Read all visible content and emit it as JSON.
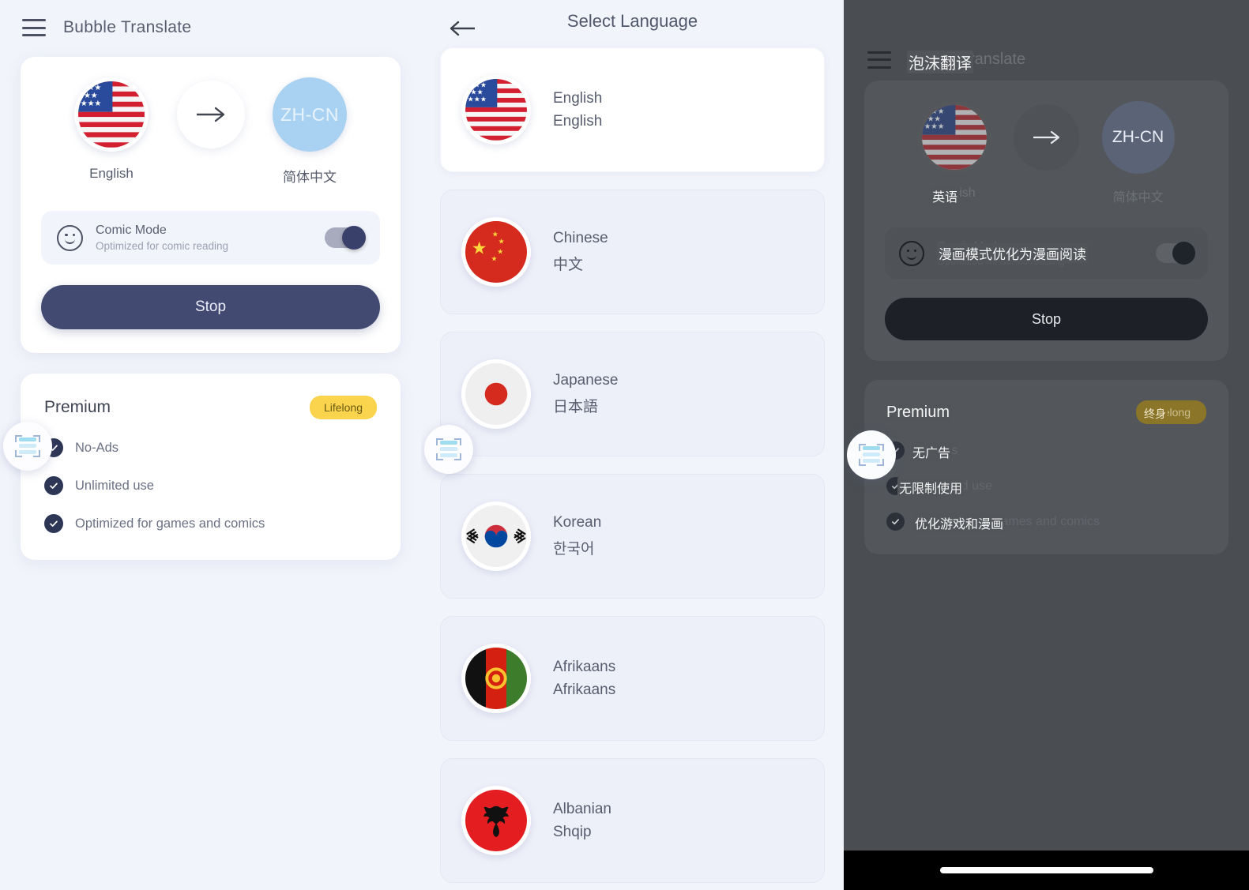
{
  "main_panel": {
    "header": {
      "menu_icon": "hamburger-icon",
      "title": "Bubble Translate"
    },
    "translate_card": {
      "source": {
        "label": "English",
        "flag": "us-flag"
      },
      "swap_icon": "arrow-right-icon",
      "target": {
        "label": "简体中文",
        "code": "ZH-CN"
      },
      "comic_mode": {
        "icon": "smiley-icon",
        "title": "Comic Mode",
        "subtitle": "Optimized for comic reading",
        "toggle_state": "on"
      },
      "action_button": "Stop"
    },
    "premium_card": {
      "title": "Premium",
      "badge": "Lifelong",
      "features": [
        "No-Ads",
        "Unlimited use",
        "Optimized for games and comics"
      ]
    },
    "floating_bubble": "translate-bubble-icon"
  },
  "language_panel": {
    "header": {
      "back_icon": "arrow-left-icon",
      "title": "Select Language"
    },
    "items": [
      {
        "name": "English",
        "native": "English",
        "flag": "us-flag",
        "selected": true
      },
      {
        "name": "Chinese",
        "native": "中文",
        "flag": "cn-flag",
        "selected": false
      },
      {
        "name": "Japanese",
        "native": "日本語",
        "flag": "jp-flag",
        "selected": false
      },
      {
        "name": "Korean",
        "native": "한국어",
        "flag": "kr-flag",
        "selected": false
      },
      {
        "name": "Afrikaans",
        "native": "Afrikaans",
        "flag": "af-flag",
        "selected": false
      },
      {
        "name": "Albanian",
        "native": "Shqip",
        "flag": "al-flag",
        "selected": false
      }
    ],
    "floating_bubble": "translate-bubble-icon"
  },
  "overlay_panel": {
    "header": {
      "menu_icon": "hamburger-icon",
      "title_original": "Bubble Translate",
      "title_overlay": "泡沫翻译"
    },
    "translate_card": {
      "source_original": "English",
      "source_overlay": "英语",
      "target_label": "简体中文",
      "target_code": "ZH-CN",
      "comic_original_title": "Comic Mode",
      "comic_original_subtitle": "Optimized for comic reading",
      "comic_overlay": "漫画模式优化为漫画阅读",
      "action_button": "Stop"
    },
    "premium_card": {
      "title_original": "Premium",
      "title_overlay": "Premium",
      "badge_original": "Lifelong",
      "badge_overlay": "终身",
      "features": [
        {
          "original": "No-Ads",
          "overlay": "无广告"
        },
        {
          "original": "Unlimited use",
          "overlay": "无限制使用"
        },
        {
          "original": "Optimized for games and comics",
          "overlay": "优化游戏和漫画"
        }
      ]
    },
    "floating_bubble": "translate-bubble-icon",
    "nav_bar": "home-indicator"
  },
  "colors": {
    "page_bg": "#f2f4fb",
    "card_bg": "#ffffff",
    "accent_navy": "#424a72",
    "badge_yellow": "#fbd44e",
    "zh_blue": "#a9d2f2",
    "dark_bg": "#4a4e52"
  }
}
